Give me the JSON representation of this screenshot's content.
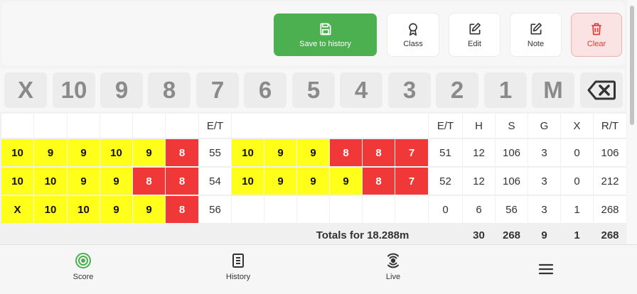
{
  "toolbar": {
    "save_label": "Save to history",
    "class_label": "Class",
    "edit_label": "Edit",
    "note_label": "Note",
    "clear_label": "Clear",
    "colors": {
      "save": "#4caf50",
      "clear_text": "#e53935"
    }
  },
  "keypad": {
    "keys": [
      "X",
      "10",
      "9",
      "8",
      "7",
      "6",
      "5",
      "4",
      "3",
      "2",
      "1",
      "M"
    ],
    "backspace_icon": "backspace-icon"
  },
  "scorecard": {
    "headers": {
      "et": "E/T",
      "h": "H",
      "s": "S",
      "g": "G",
      "x": "X",
      "rt": "R/T"
    },
    "rows": [
      {
        "end1": [
          "10",
          "9",
          "9",
          "10",
          "9",
          "8"
        ],
        "et1": "55",
        "end2": [
          "10",
          "9",
          "9",
          "8",
          "8",
          "7"
        ],
        "et2": "51",
        "h": "12",
        "s": "106",
        "g": "3",
        "x": "0",
        "rt": "106"
      },
      {
        "end1": [
          "10",
          "10",
          "9",
          "9",
          "8",
          "8"
        ],
        "et1": "54",
        "end2": [
          "10",
          "9",
          "9",
          "9",
          "8",
          "7"
        ],
        "et2": "52",
        "h": "12",
        "s": "106",
        "g": "3",
        "x": "0",
        "rt": "212"
      },
      {
        "end1": [
          "X",
          "10",
          "10",
          "9",
          "9",
          "8"
        ],
        "et1": "56",
        "end2": [
          "",
          "",
          "",
          "",
          "",
          ""
        ],
        "et2": "0",
        "h": "6",
        "s": "56",
        "g": "3",
        "x": "1",
        "rt": "268"
      }
    ],
    "totals": {
      "label": "Totals for 18.288m",
      "h": "30",
      "s": "268",
      "g": "9",
      "x": "1",
      "rt": "268"
    },
    "colors": {
      "gold": "#ffff1a",
      "red": "#f03838"
    }
  },
  "nav": {
    "score": "Score",
    "history": "History",
    "live": "Live",
    "menu_icon": "hamburger-menu-icon"
  }
}
